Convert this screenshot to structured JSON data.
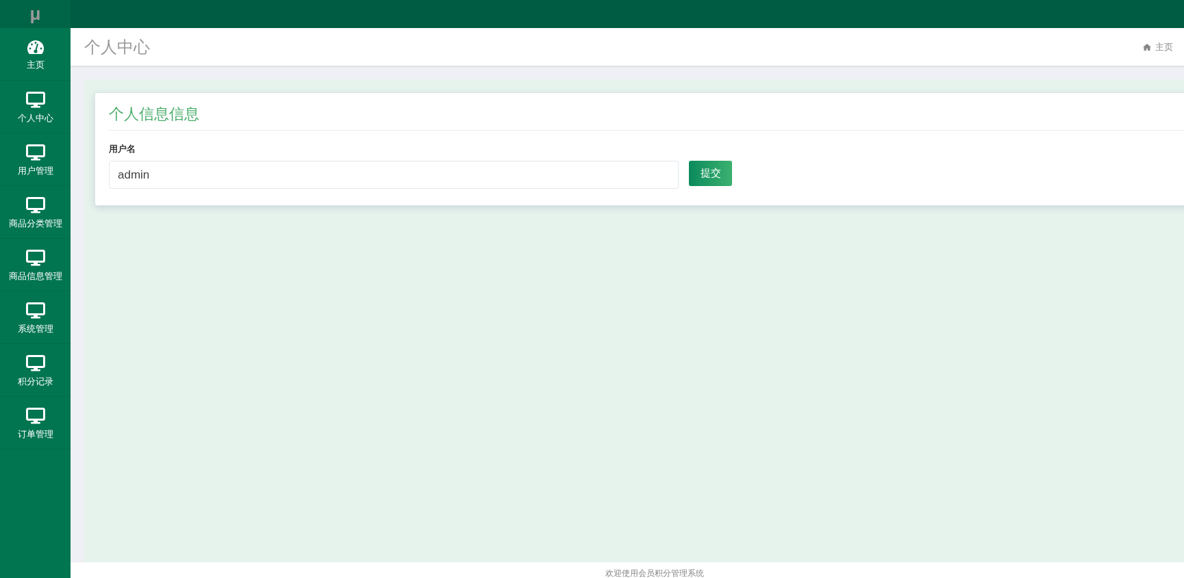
{
  "logo": "μ",
  "sidebar": {
    "items": [
      {
        "label": "主页",
        "kind": "dashboard"
      },
      {
        "label": "个人中心",
        "kind": "monitor"
      },
      {
        "label": "用户管理",
        "kind": "monitor"
      },
      {
        "label": "商品分类管理",
        "kind": "monitor"
      },
      {
        "label": "商品信息管理",
        "kind": "monitor"
      },
      {
        "label": "系统管理",
        "kind": "monitor"
      },
      {
        "label": "积分记录",
        "kind": "monitor"
      },
      {
        "label": "订单管理",
        "kind": "monitor"
      }
    ]
  },
  "header": {
    "title": "个人中心",
    "breadcrumb": "主页"
  },
  "card": {
    "title": "个人信息信息",
    "field_label": "用户名",
    "field_value": "admin",
    "submit": "提交"
  },
  "footer": "欢迎使用会员积分管理系统"
}
